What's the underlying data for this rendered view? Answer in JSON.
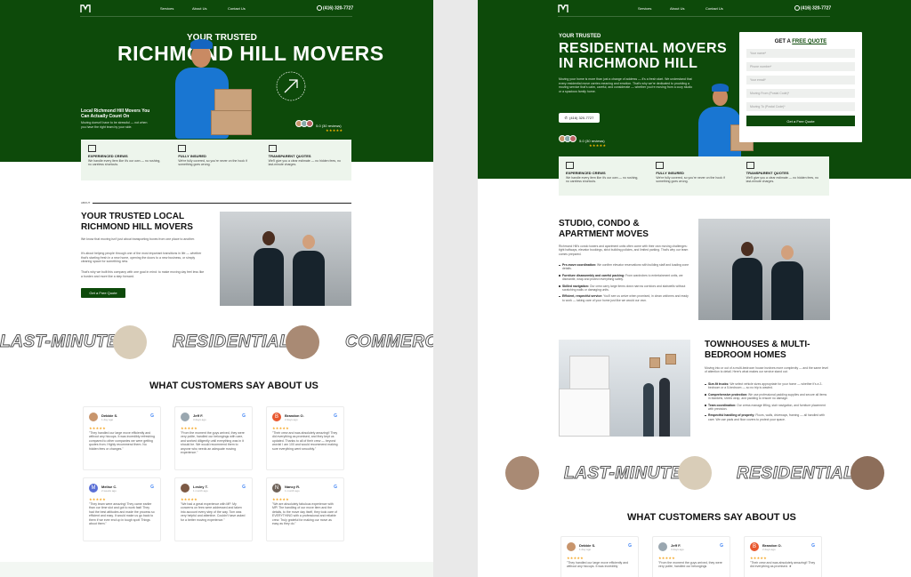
{
  "left": {
    "nav": {
      "services": "Services",
      "about": "About Us",
      "contact": "Contact Us",
      "phone": "(416) 320-7727"
    },
    "hero": {
      "eyebrow": "YOUR TRUSTED",
      "title": "RICHMOND HILL MOVERS",
      "subtitle": "Local Richmond Hill Movers You Can Actually Count On",
      "desc": "Moving doesn't have to be stressful — not when you have the right team by your side.",
      "rating": "5.0",
      "rating_reviews": "(30 reviews)",
      "stars": "★★★★★"
    },
    "features": [
      {
        "title": "EXPERIENCED CREWS",
        "desc": "We handle every item like it's our own — no rushing, no careless shortcuts."
      },
      {
        "title": "FULLY INSURED",
        "desc": "We're fully covered, so you're never on the hook if something goes wrong."
      },
      {
        "title": "TRANSPARENT QUOTES",
        "desc": "We'll give you a clear estimate — no hidden fees, no last-minute charges."
      }
    ],
    "about": {
      "label": "ABOUT",
      "title": "YOUR TRUSTED LOCAL RICHMOND HILL MOVERS",
      "p1": "We know that moving isn't just about transporting boxes from one place to another.",
      "p2": "It's about helping people through one of the most important transitions in life — whether that's starting fresh in a new home, opening the doors to a new business, or simply clearing space for something new.",
      "p3": "That's why we built this company with one goal in mind: to make moving day feel less like a burden and more like a step forward.",
      "cta": "Get a Free Quote"
    },
    "marquee": [
      "LAST-MINUTE",
      "RESIDENTIAL",
      "COMMERCIAL"
    ],
    "reviews_title": "WHAT CUSTOMERS SAY ABOUT US",
    "reviews": [
      {
        "name": "Debbie S.",
        "date": "1 day ago",
        "stars": "★★★★★",
        "text": "\"They handled our large move efficiently and without any hiccups. It was incredibly refreshing compared to other companies we were getting quotes from. Highly recommend them. No hidden fees or changes.\"",
        "avatar": "#c8956c"
      },
      {
        "name": "Jeff F.",
        "date": "3 days ago",
        "stars": "★★★★★",
        "text": "\"From the moment the guys arrived, they were very polite, handled our belongings with care, and worked diligently until everything was in it should be. We would recommend them to anyone who needs an adequate moving experience.\"",
        "avatar": "#9aa7b0"
      },
      {
        "name": "Brandon O.",
        "date": "2 days ago",
        "stars": "★★★★★",
        "text": "\"Their crew and was absolutely amazing!! They did everything as promised, and they kept us updated. Thanks to all of their crew — beyond words! I am 100 and would recommend making sure everything went smoothly.\"",
        "avatar": "#e8572e",
        "initial": "B"
      },
      {
        "name": "Melise C.",
        "date": "2 weeks ago",
        "stars": "★★★★★",
        "text": "\"They team were amazing! They came earlier than our time slot and got to work fast! They had the best attitudes and made the process so efficient and easy. It would make us go back to them if we ever end up in tough spot! Things about them.\"",
        "avatar": "#5a6fd6",
        "initial": "M"
      },
      {
        "name": "Lesley T.",
        "date": "1 month ago",
        "stars": "★★★★★",
        "text": "\"We had a great experience with MP. My concerns on fees were addressed and taken into account every step of the way. Tom was very helpful and attentive. Couldn't have asked for a better moving experience.\"",
        "avatar": "#7d5a45"
      },
      {
        "name": "Nancy R.",
        "date": "1 month ago",
        "stars": "★★★★★",
        "text": "\"We are absolutely fabulous experience with MP! The handling of our move item and the details, to the move day itself, they took care of EVERYTHING with a professional and reliable crew. Truly grateful for making our move as easy as they do.\"",
        "avatar": "#6e6259",
        "initial": "N"
      }
    ]
  },
  "right": {
    "nav": {
      "services": "Services",
      "about": "About Us",
      "contact": "Contact Us",
      "phone": "(416) 320-7727"
    },
    "hero": {
      "eyebrow": "YOUR TRUSTED",
      "title1": "RESIDENTIAL MOVERS",
      "title2": "IN RICHMOND HILL",
      "desc": "Moving your home is more than just a change of address — it's a fresh start. We understand that every residential move carries meaning and emotion. That's why we're dedicated to providing a moving service that's calm, careful, and considerate — whether you're moving from a cozy studio or a spacious family home.",
      "phone_btn": "(416) 320-7727",
      "rating": "5.0",
      "rating_reviews": "(30 reviews)",
      "stars": "★★★★★"
    },
    "quote": {
      "title_a": "GET A ",
      "title_b": "FREE QUOTE",
      "fields": [
        "Your name*",
        "Phone number*",
        "Your email*",
        "Moving From (Postal Code)*",
        "Moving To (Postal Code)*"
      ],
      "submit": "Get a Free Quote"
    },
    "features": [
      {
        "title": "EXPERIENCED CREWS",
        "desc": "We handle every item like it's our own — no rushing, no careless shortcuts."
      },
      {
        "title": "FULLY INSURED",
        "desc": "We're fully covered, so you're never on the hook if something goes wrong."
      },
      {
        "title": "TRANSPARENT QUOTES",
        "desc": "We'll give you a clear estimate — no hidden fees, no last-minute charges."
      }
    ],
    "studio": {
      "title": "STUDIO, CONDO & APARTMENT MOVES",
      "intro": "Richmond Hill's condo towers and apartment units often come with their own moving challenges: tight hallways, elevator bookings, strict building policies, and limited parking. That's why our team comes prepared.",
      "bullets": [
        {
          "b": "Pre-move coordination:",
          "t": " We confirm elevator reservations with building staff and loading zone details."
        },
        {
          "b": "Furniture disassembly and careful packing:",
          "t": " From wardrobes to entertainment units, we dismantle, wrap and protect everything safely."
        },
        {
          "b": "Skilled navigation:",
          "t": " Our crew carry large items down narrow corridors and stairwells without scratching walls or damaging units."
        },
        {
          "b": "Efficient, respectful service:",
          "t": " You'll see us arrive when promised, in clean uniforms and ready to work — taking care of your home just like we would our own."
        }
      ]
    },
    "townhouse": {
      "title": "TOWNHOUSES & MULTI-BEDROOM HOMES",
      "intro": "Moving into or out of a multi-bedroom house involves more complexity — and the same level of attention to detail. Here's what makes our service stand out:",
      "bullets": [
        {
          "b": "Size-fit trucks:",
          "t": " We select vehicle sizes appropriate for your home — whether it's a 2-bedroom or a 5-bedroom — so no trip is wasted."
        },
        {
          "b": "Comprehensive protection:",
          "t": " We use professional padding supplies and secure all items in blankets, shrink wrap, and padding to ensure no damage."
        },
        {
          "b": "Team coordination:",
          "t": " Our crews manage lifting, stair navigation, and furniture placement with precision."
        },
        {
          "b": "Respectful handling of property:",
          "t": " Floors, walls, driveways, framing — all handled with care. We use pads and floor covers to protect your space."
        }
      ]
    },
    "marquee": [
      "LAST-MINUTE",
      "RESIDENTIAL"
    ],
    "reviews_title": "WHAT CUSTOMERS SAY ABOUT US",
    "reviews": [
      {
        "name": "Debbie S.",
        "date": "1 day ago",
        "stars": "★★★★★",
        "text": "\"They handled our large move efficiently and without any hiccups. It was incredibly",
        "avatar": "#c8956c"
      },
      {
        "name": "Jeff F.",
        "date": "3 days ago",
        "stars": "★★★★★",
        "text": "\"From the moment the guys arrived, they were very polite, handled our belongings",
        "avatar": "#9aa7b0"
      },
      {
        "name": "Brandon O.",
        "date": "2 days ago",
        "stars": "★★★★★",
        "text": "\"Their crew and was absolutely amazing!! They did everything as promised. ★",
        "avatar": "#e8572e",
        "initial": "B"
      }
    ]
  }
}
